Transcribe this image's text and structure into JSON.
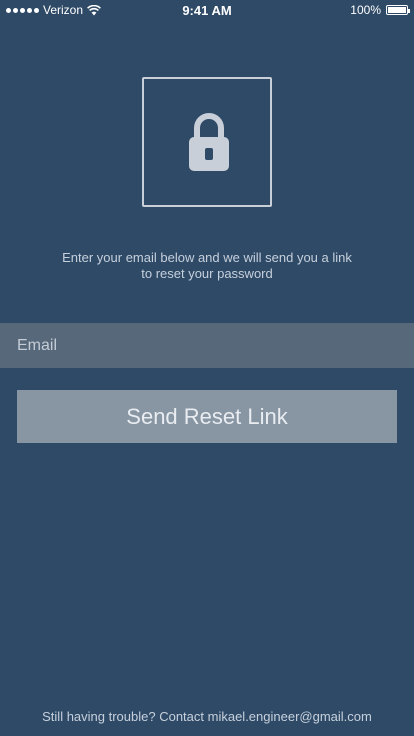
{
  "status_bar": {
    "carrier": "Verizon",
    "time": "9:41 AM",
    "battery_percent": "100%",
    "battery_level": 1.0,
    "signal_bars": 5,
    "icons": [
      "signal-dots-icon",
      "wifi-icon",
      "battery-icon"
    ]
  },
  "lock": {
    "icon": "lock-icon",
    "color": "#c9cfd8"
  },
  "instructions": {
    "text": "Enter your email below and we will send you a link to reset your password"
  },
  "form": {
    "email_placeholder": "Email",
    "email_value": "",
    "send_button_label": "Send Reset Link"
  },
  "footer": {
    "text": "Still having trouble? Contact mikael.engineer@gmail.com"
  },
  "colors": {
    "background": "#2f4a67",
    "input_background": "#57687b",
    "button_background": "#8895a3",
    "muted_text": "#c6d0dc"
  }
}
